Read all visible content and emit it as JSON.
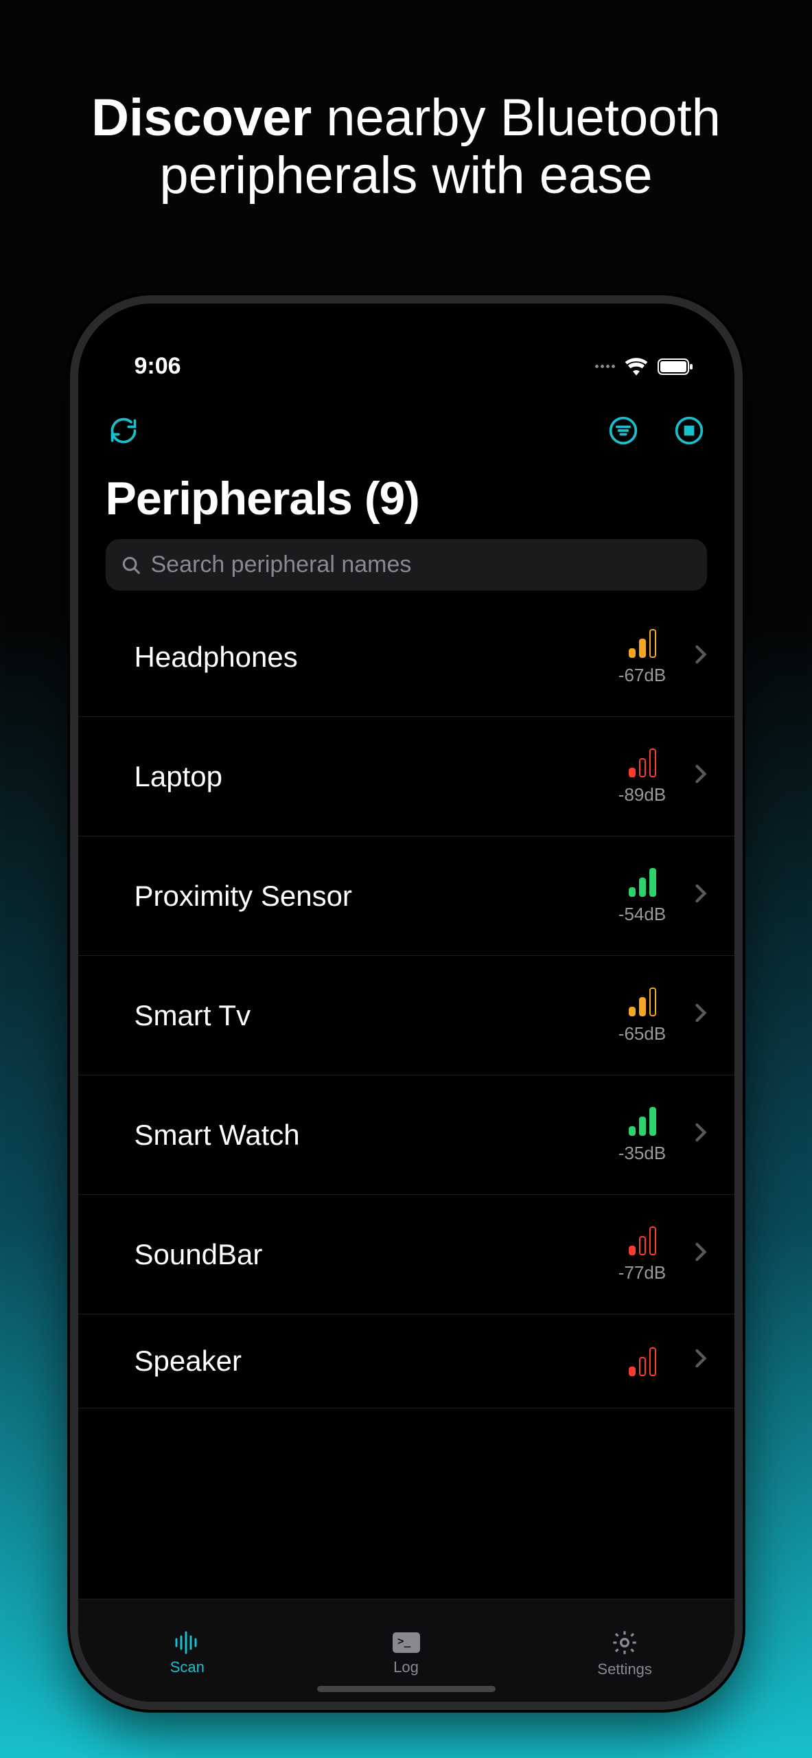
{
  "promo": {
    "bold": "Discover",
    "rest": " nearby Bluetooth peripherals with ease"
  },
  "status": {
    "time": "9:06"
  },
  "page": {
    "title_prefix": "Peripherals",
    "count": 9
  },
  "search": {
    "placeholder": "Search peripheral names"
  },
  "peripherals": [
    {
      "name": "Headphones",
      "rssi": "-67dB",
      "strength": "medium",
      "color": "orange"
    },
    {
      "name": "Laptop",
      "rssi": "-89dB",
      "strength": "low",
      "color": "red"
    },
    {
      "name": "Proximity Sensor",
      "rssi": "-54dB",
      "strength": "high",
      "color": "green"
    },
    {
      "name": "Smart Tv",
      "rssi": "-65dB",
      "strength": "medium",
      "color": "orange"
    },
    {
      "name": "Smart Watch",
      "rssi": "-35dB",
      "strength": "high",
      "color": "green"
    },
    {
      "name": "SoundBar",
      "rssi": "-77dB",
      "strength": "low",
      "color": "red"
    },
    {
      "name": "Speaker",
      "rssi": "",
      "strength": "low",
      "color": "red"
    }
  ],
  "tabs": {
    "scan": "Scan",
    "log": "Log",
    "settings": "Settings"
  },
  "colors": {
    "accent": "#17c0cc"
  }
}
